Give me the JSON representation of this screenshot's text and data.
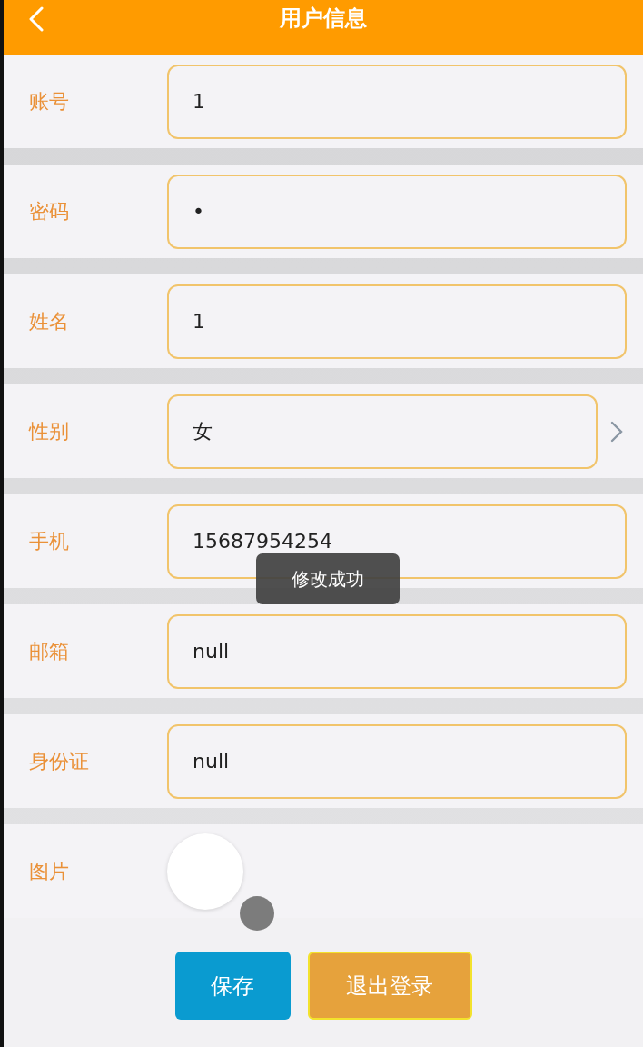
{
  "header": {
    "title": "用户信息"
  },
  "fields": [
    {
      "kind": "input",
      "label": "账号",
      "value": "1"
    },
    {
      "kind": "input",
      "label": "密码",
      "value": "•"
    },
    {
      "kind": "input",
      "label": "姓名",
      "value": "1"
    },
    {
      "kind": "select",
      "label": "性别",
      "value": "女"
    },
    {
      "kind": "input",
      "label": "手机",
      "value": "15687954254"
    },
    {
      "kind": "input",
      "label": "邮箱",
      "value": "null"
    },
    {
      "kind": "input",
      "label": "身份证",
      "value": "null"
    },
    {
      "kind": "image",
      "label": "图片"
    }
  ],
  "toast": {
    "text": "修改成功"
  },
  "buttons": [
    {
      "kind": "primary",
      "label": "保存"
    },
    {
      "kind": "secondary",
      "label": "退出登录"
    }
  ]
}
